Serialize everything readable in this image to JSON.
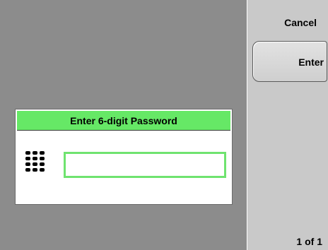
{
  "softkeys": {
    "cancel_label": "Cancel",
    "enter_label": "Enter",
    "page_indicator": "1 of 1"
  },
  "dialog": {
    "title": "Enter 6-digit Password",
    "password_value": "",
    "keypad_icon": "keypad-icon"
  },
  "colors": {
    "background": "#8c8c8c",
    "softkey_panel": "#c9c9c9",
    "dialog_title_bg": "#66e866",
    "field_border": "#6fe36f"
  }
}
